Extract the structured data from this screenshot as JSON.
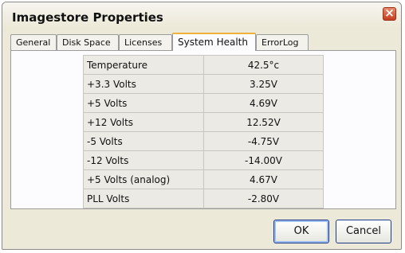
{
  "window": {
    "title": "Imagestore Properties"
  },
  "tabs": [
    {
      "label": "General"
    },
    {
      "label": "Disk Space"
    },
    {
      "label": "Licenses"
    },
    {
      "label": "System Health",
      "active": true
    },
    {
      "label": "ErrorLog"
    }
  ],
  "health": {
    "rows": [
      {
        "name": "Temperature",
        "value": "42.5°c"
      },
      {
        "name": "+3.3 Volts",
        "value": "3.25V"
      },
      {
        "name": "+5 Volts",
        "value": "4.69V"
      },
      {
        "name": "+12 Volts",
        "value": "12.52V"
      },
      {
        "name": "-5 Volts",
        "value": "-4.75V"
      },
      {
        "name": "-12 Volts",
        "value": "-14.00V"
      },
      {
        "name": "+5 Volts (analog)",
        "value": "4.67V"
      },
      {
        "name": "PLL Volts",
        "value": "-2.80V"
      }
    ]
  },
  "buttons": {
    "ok": "OK",
    "cancel": "Cancel"
  },
  "icons": {
    "close": "close-icon"
  }
}
